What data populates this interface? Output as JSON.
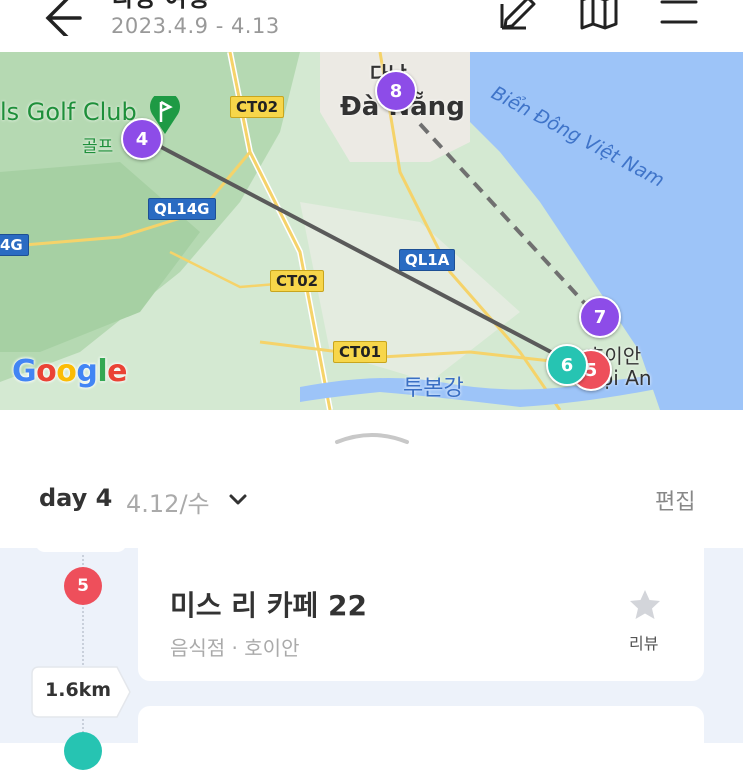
{
  "header": {
    "title": "다낭 여행",
    "dates": "2023.4.9 - 4.13",
    "back_icon": "arrow-left-icon",
    "edit_icon": "pencil-note-icon",
    "map_icon": "folded-map-icon",
    "menu_icon": "hamburger-menu-icon"
  },
  "map": {
    "labels": {
      "golf_club": "ls Golf Club",
      "golf_kor": "골프",
      "da_nang_kor": "다낭",
      "da_nang": "Đà Nẵng",
      "sea": "Biển Đông Việt Nam",
      "hoi_an_kor": "호이안",
      "hoi_an": "Hội An",
      "river": "투본강",
      "google": "Google"
    },
    "roads": [
      "CT02",
      "QL14G",
      "4G",
      "CT02",
      "QL1A",
      "CT01"
    ],
    "pins": [
      {
        "number": "4",
        "color": "#8d4ce8"
      },
      {
        "number": "8",
        "color": "#8d4ce8"
      },
      {
        "number": "7",
        "color": "#8d4ce8"
      },
      {
        "number": "6",
        "color": "#26c4b2"
      },
      {
        "number": "5",
        "color": "#ee4f5b"
      }
    ],
    "golf_icon": "golf-flag-icon"
  },
  "sheet": {
    "day_label": "day 4",
    "day_date": "4.12/수",
    "edit_label": "편집",
    "chevron_icon": "chevron-down-icon",
    "place": {
      "number": "5",
      "name": "미스 리 카페 22",
      "meta": "음식점 · 호이안",
      "review_label": "리뷰",
      "star_icon": "star-icon"
    },
    "distance": "1.6km",
    "next_number": ""
  },
  "colors": {
    "accent_purple": "#8d4ce8",
    "accent_red": "#ee4f5b",
    "accent_teal": "#26c4b2",
    "timeline_bg": "#edf2fa"
  }
}
